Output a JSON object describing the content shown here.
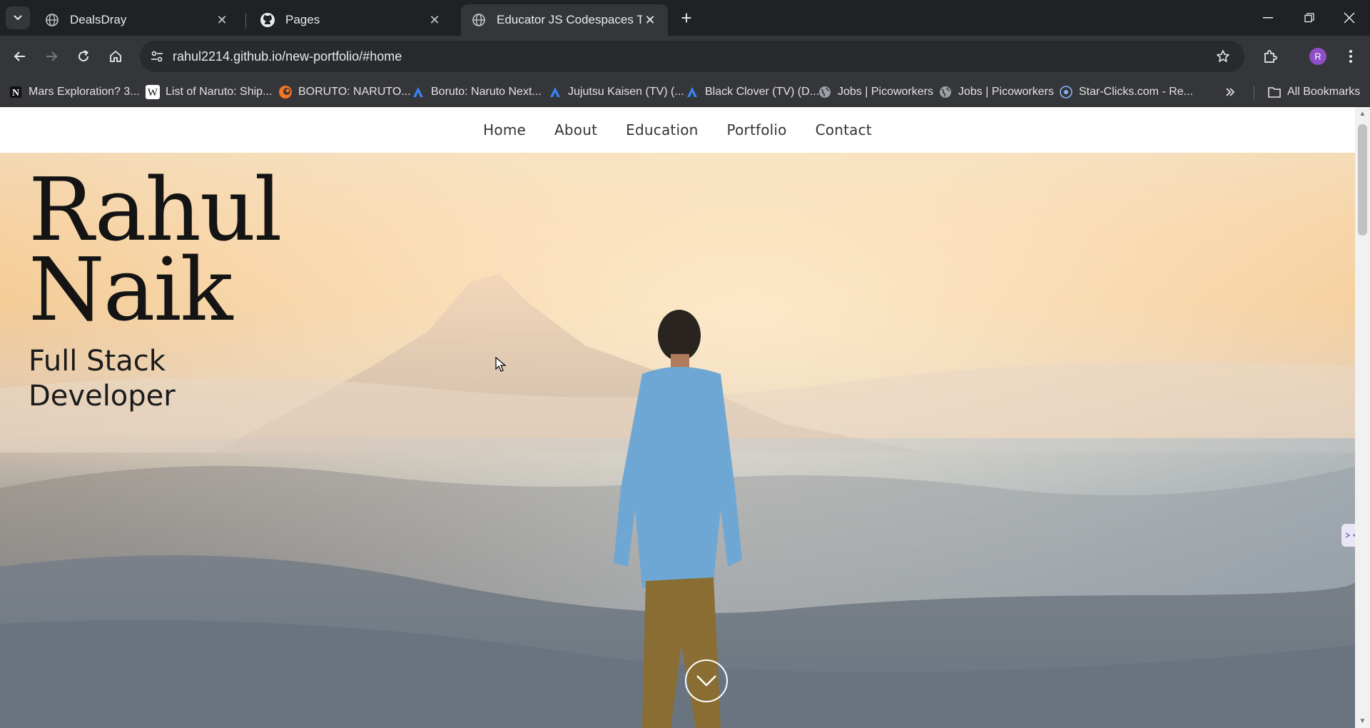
{
  "browser": {
    "tabs": [
      {
        "title": "DealsDray",
        "icon": "globe-icon",
        "active": false
      },
      {
        "title": "Pages",
        "icon": "github-icon",
        "active": false
      },
      {
        "title": "Educator JS Codespaces Templa",
        "icon": "globe-icon",
        "active": true
      }
    ],
    "url": "rahul2214.github.io/new-portfolio/#home",
    "profile_initial": "R",
    "profile_color": "#8e4ec6",
    "bookmarks": [
      {
        "label": "Mars Exploration? 3...",
        "icon": "notion-icon"
      },
      {
        "label": "List of Naruto: Ship...",
        "icon": "wikipedia-icon"
      },
      {
        "label": "BORUTO: NARUTO...",
        "icon": "crunchyroll-icon"
      },
      {
        "label": "Boruto: Naruto Next...",
        "icon": "anime-site-icon"
      },
      {
        "label": "Jujutsu Kaisen (TV) (...",
        "icon": "anime-site-icon"
      },
      {
        "label": "Black Clover (TV) (D...",
        "icon": "anime-site-icon"
      },
      {
        "label": "Jobs | Picoworkers",
        "icon": "globe-icon"
      },
      {
        "label": "Jobs | Picoworkers",
        "icon": "globe-icon"
      },
      {
        "label": "Star-Clicks.com - Re...",
        "icon": "star-clicks-icon"
      }
    ],
    "all_bookmarks_label": "All Bookmarks"
  },
  "site": {
    "nav": [
      "Home",
      "About",
      "Education",
      "Portfolio",
      "Contact"
    ],
    "hero": {
      "name_line1": "Rahul",
      "name_line2": "Naik",
      "role_line1": "Full Stack",
      "role_line2": "Developer"
    }
  }
}
